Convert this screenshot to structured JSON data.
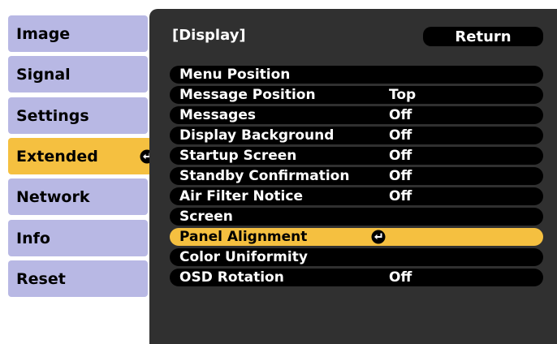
{
  "tabs": [
    {
      "label": "Image",
      "selected": false
    },
    {
      "label": "Signal",
      "selected": false
    },
    {
      "label": "Settings",
      "selected": false
    },
    {
      "label": "Extended",
      "selected": true
    },
    {
      "label": "Network",
      "selected": false
    },
    {
      "label": "Info",
      "selected": false
    },
    {
      "label": "Reset",
      "selected": false
    }
  ],
  "panel": {
    "title": "[Display]",
    "return_label": "Return"
  },
  "menu": [
    {
      "label": "Menu Position",
      "value": ""
    },
    {
      "label": "Message Position",
      "value": "Top"
    },
    {
      "label": "Messages",
      "value": "Off"
    },
    {
      "label": "Display Background",
      "value": "Off"
    },
    {
      "label": "Startup Screen",
      "value": "Off"
    },
    {
      "label": "Standby Confirmation",
      "value": "Off"
    },
    {
      "label": "Air Filter Notice",
      "value": "Off"
    },
    {
      "label": "Screen",
      "value": ""
    },
    {
      "label": "Panel Alignment",
      "value": "",
      "selected": true
    },
    {
      "label": "Color Uniformity",
      "value": ""
    },
    {
      "label": "OSD Rotation",
      "value": "Off"
    }
  ],
  "icons": {
    "enter": "enter-return-icon"
  },
  "colors": {
    "tab_bg": "#b8b8e4",
    "selected_bg": "#f5c040",
    "panel_bg": "#303030",
    "row_bg": "#000000"
  }
}
